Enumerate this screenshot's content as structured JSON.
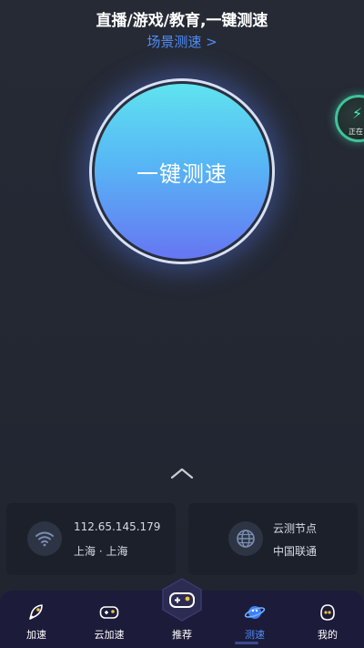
{
  "header": {
    "title": "直播/游戏/教育,一键测速",
    "scene_link": "场景测速 >"
  },
  "main_button": {
    "label": "一键测速"
  },
  "floating": {
    "status": "正在",
    "icon": "lightning-icon"
  },
  "network_card": {
    "ip": "112.65.145.179",
    "location": "上海 · 上海",
    "icon": "wifi-icon"
  },
  "node_card": {
    "title": "云测节点",
    "isp": "中国联通",
    "icon": "globe-icon"
  },
  "tabs": [
    {
      "label": "加速",
      "icon": "rocket-icon"
    },
    {
      "label": "云加速",
      "icon": "gamepad-icon"
    },
    {
      "label": "推荐",
      "icon": "gamepad-hex-icon"
    },
    {
      "label": "测速",
      "icon": "planet-icon"
    },
    {
      "label": "我的",
      "icon": "profile-icon"
    }
  ],
  "colors": {
    "accent": "#4f8df5",
    "button_top": "#5fe3ef",
    "button_bottom": "#6676f2",
    "float_ring": "#3fc39a"
  }
}
